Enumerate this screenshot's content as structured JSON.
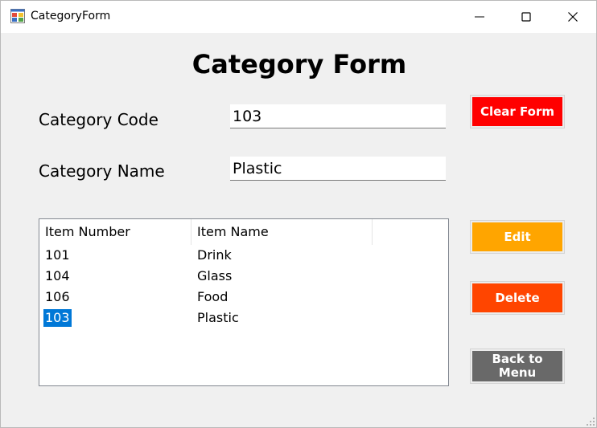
{
  "window": {
    "title": "CategoryForm"
  },
  "form": {
    "heading": "Category Form",
    "code_label": "Category Code",
    "code_value": "103",
    "name_label": "Category Name",
    "name_value": "Plastic"
  },
  "buttons": {
    "clear": "Clear Form",
    "edit": "Edit",
    "delete": "Delete",
    "back": "Back to Menu"
  },
  "list": {
    "columns": [
      "Item Number",
      "Item Name"
    ],
    "rows": [
      {
        "number": "101",
        "name": "Drink",
        "selected": false
      },
      {
        "number": "104",
        "name": "Glass",
        "selected": false
      },
      {
        "number": "106",
        "name": "Food",
        "selected": false
      },
      {
        "number": "103",
        "name": "Plastic",
        "selected": true
      }
    ]
  },
  "colors": {
    "clear_button": "#ff0000",
    "edit_button": "#ffa500",
    "delete_button": "#ff4500",
    "back_button": "#696969",
    "selection": "#0078d7"
  },
  "icons": {
    "app": "form-icon",
    "minimize": "minimize-icon",
    "maximize": "maximize-icon",
    "close": "close-icon"
  }
}
